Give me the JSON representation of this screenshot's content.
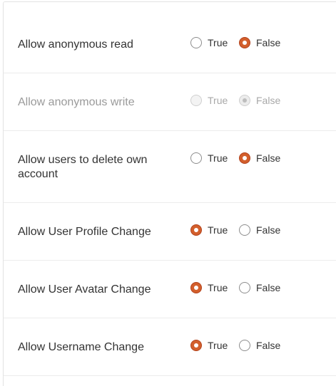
{
  "settings": [
    {
      "label": "Allow anonymous read",
      "options": [
        "True",
        "False"
      ],
      "selected": "False",
      "disabled": false
    },
    {
      "label": "Allow anonymous write",
      "options": [
        "True",
        "False"
      ],
      "selected": "False",
      "disabled": true
    },
    {
      "label": "Allow users to delete own account",
      "options": [
        "True",
        "False"
      ],
      "selected": "False",
      "disabled": false
    },
    {
      "label": "Allow User Profile Change",
      "options": [
        "True",
        "False"
      ],
      "selected": "True",
      "disabled": false
    },
    {
      "label": "Allow User Avatar Change",
      "options": [
        "True",
        "False"
      ],
      "selected": "True",
      "disabled": false
    },
    {
      "label": "Allow Username Change",
      "options": [
        "True",
        "False"
      ],
      "selected": "True",
      "disabled": false
    }
  ],
  "colors": {
    "accent": "#d35f2c",
    "text": "#333333",
    "disabled_text": "#9a9a9a",
    "divider": "#ececec"
  }
}
